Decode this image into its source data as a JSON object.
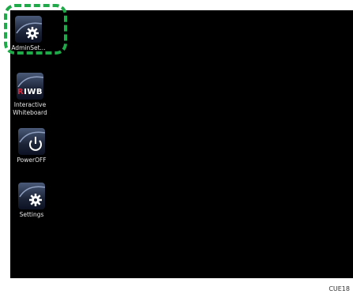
{
  "desktop": {
    "icons": [
      {
        "label": "AdminSet...",
        "icon": "gear-icon"
      },
      {
        "label_line1": "Interactive",
        "label_line2": "Whiteboard",
        "icon": "riwb-logo",
        "logo_text": "RIWB"
      },
      {
        "label": "PowerOFF",
        "icon": "power-icon"
      },
      {
        "label": "Settings",
        "icon": "gear-icon"
      }
    ]
  },
  "highlight_color": "#1faa4a",
  "caption": "CUE18"
}
